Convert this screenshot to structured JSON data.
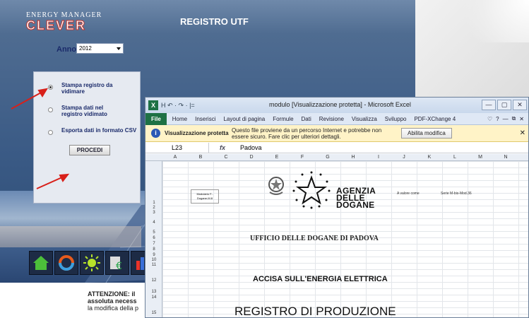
{
  "app": {
    "logo_line1": "ENERGY MANAGER",
    "logo_line2": "CLEVER",
    "title": "REGISTRO UTF",
    "anno_label": "Anno",
    "anno_value": "2012",
    "options": [
      {
        "label": "Stampa registro da vidimare",
        "selected": true
      },
      {
        "label": "Stampa dati nel registro vidimato",
        "selected": false
      },
      {
        "label": "Esporta dati in formato CSV",
        "selected": false
      }
    ],
    "procedi": "PROCEDI",
    "warning_line1": "ATTENZIONE: il",
    "warning_line2": "assoluta necess",
    "warning_line3": "la modifica della p"
  },
  "excel": {
    "qat_icons": "H ↶ · ↷ · |=",
    "title": "modulo  [Visualizzazione protetta]  -  Microsoft Excel",
    "win_buttons": [
      "—",
      "▢",
      "✕"
    ],
    "file_tab": "File",
    "tabs": [
      "Home",
      "Inserisci",
      "Layout di pagina",
      "Formule",
      "Dati",
      "Revisione",
      "Visualizza",
      "Sviluppo",
      "PDF-XChange 4"
    ],
    "ribbon_right": [
      "♡",
      "?",
      "—",
      "⧉",
      "✕"
    ],
    "protected_title": "Visualizzazione protetta",
    "protected_msg": "Questo file proviene da un percorso Internet e potrebbe non essere sicuro. Fare clic per ulteriori dettagli.",
    "enable_button": "Abilita modifica",
    "cell_ref": "L23",
    "fx": "fx",
    "formula_value": "Padova",
    "columns": [
      "A",
      "B",
      "C",
      "D",
      "E",
      "F",
      "G",
      "H",
      "I",
      "J",
      "K",
      "L",
      "M",
      "N"
    ],
    "rows": [
      "1",
      "2",
      "3",
      "4",
      "5",
      "6",
      "7",
      "8",
      "9",
      "10",
      "11",
      "12",
      "13",
      "14",
      "15"
    ],
    "stamp_text": "Modulario F.-Dogane-M.8",
    "agency": [
      "AGENZIA",
      "DELLE",
      "DOGANE"
    ],
    "valore": "A valore come",
    "serie": "Serie M-bis-Mod.36",
    "ufficio": "UFFICIO DELLE DOGANE DI PADOVA",
    "accisa": "ACCISA SULL'ENERGIA ELETTRICA",
    "registro": "REGISTRO DI PRODUZIONE"
  },
  "colors": {
    "arrow": "#d8201a",
    "excel_green": "#1e7145",
    "panel_bg": "#e6eaf1"
  }
}
